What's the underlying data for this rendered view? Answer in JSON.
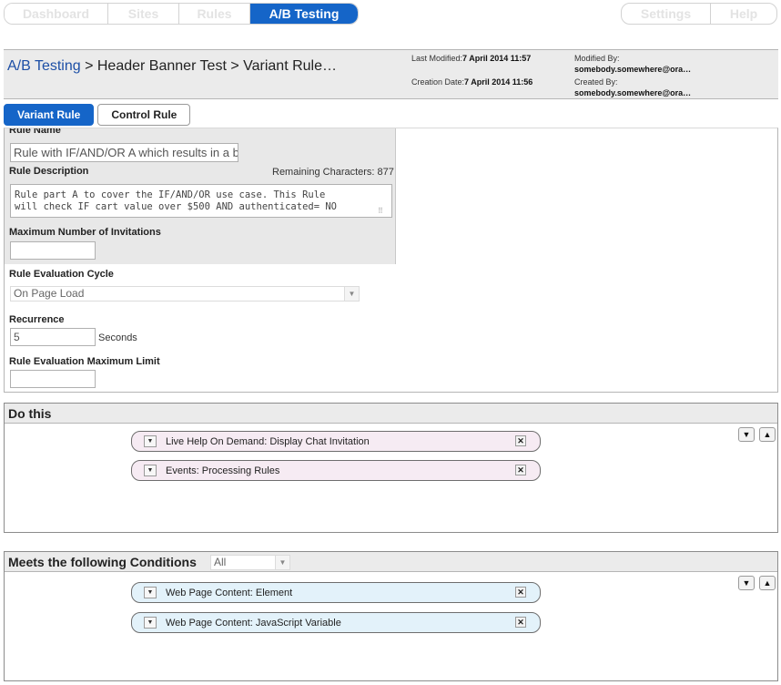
{
  "topnav": {
    "items": [
      "Dashboard",
      "Sites",
      "Rules",
      "A/B Testing"
    ],
    "right_items": [
      "Settings",
      "Help"
    ]
  },
  "header": {
    "breadcrumb_link": "A/B Testing",
    "breadcrumb_rest": " > Header Banner Test > Variant Rule…",
    "last_modified_label": "Last Modified:",
    "last_modified_value": "7 April 2014 11:57",
    "creation_date_label": "Creation Date:",
    "creation_date_value": "7 April 2014 11:56",
    "modified_by_label": "Modified By:",
    "modified_by_value": "somebody.somewhere@ora…",
    "created_by_label": "Created By:",
    "created_by_value": "somebody.somewhere@ora…"
  },
  "tabs": {
    "variant": "Variant Rule",
    "control": "Control Rule"
  },
  "form": {
    "rule_name_label": "Rule Name",
    "rule_name_value": "Rule with IF/AND/OR A which results in a b",
    "rule_desc_label": "Rule Description",
    "remaining_chars": "Remaining Characters: 877",
    "rule_desc_value": "Rule part A to cover the IF/AND/OR use case. This Rule\nwill check IF cart value over $500 AND authenticated= NO",
    "max_invitations_label": "Maximum Number of Invitations",
    "max_invitations_value": "",
    "eval_cycle_label": "Rule Evaluation Cycle",
    "eval_cycle_value": "On Page Load",
    "recurrence_label": "Recurrence",
    "recurrence_value": "5",
    "recurrence_unit": "Seconds",
    "max_limit_label": "Rule Evaluation Maximum Limit",
    "max_limit_value": ""
  },
  "do_this": {
    "title": "Do this",
    "actions": [
      "Live Help On Demand: Display Chat Invitation",
      "Events: Processing Rules"
    ]
  },
  "conditions": {
    "title": "Meets the following Conditions",
    "match_value": "All",
    "items": [
      "Web Page Content: Element",
      "Web Page Content: JavaScript Variable"
    ]
  },
  "icons": {
    "dropdown": "chevron-down-icon",
    "remove": "close-icon",
    "move_down": "move-down-icon",
    "move_up": "move-up-icon"
  }
}
